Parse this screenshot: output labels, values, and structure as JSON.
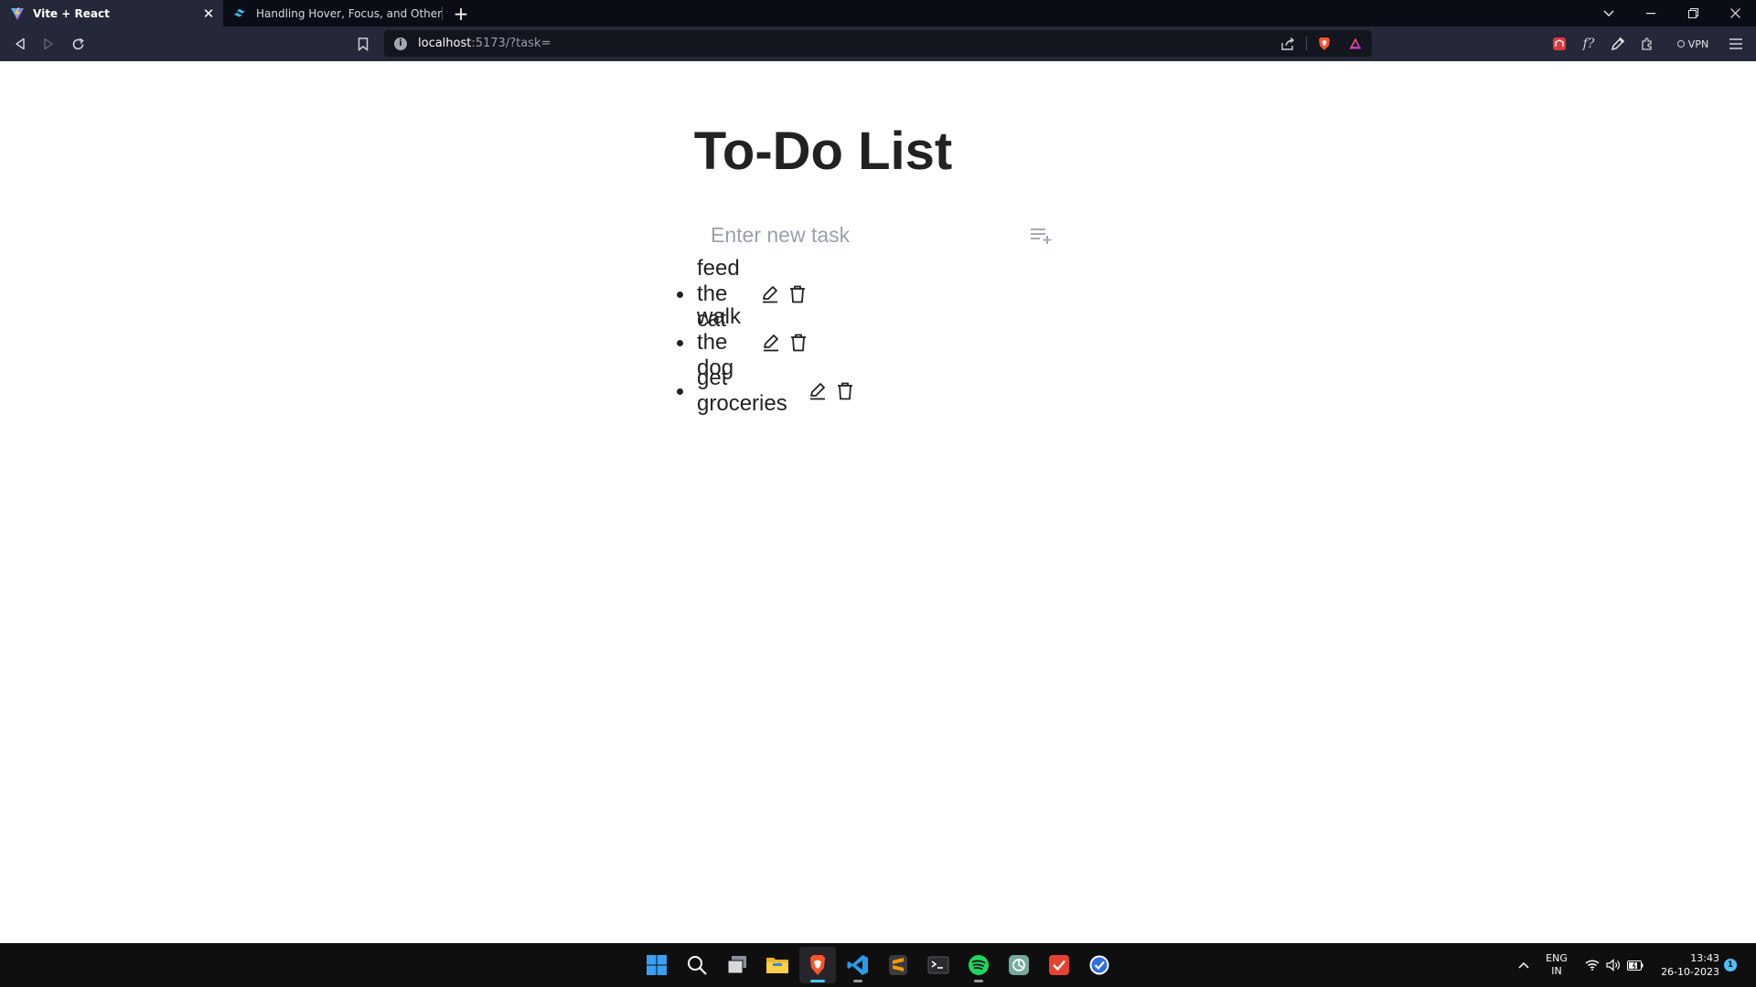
{
  "browser": {
    "tabs": [
      {
        "title": "Vite + React",
        "favicon": "vite-icon",
        "active": true
      },
      {
        "title": "Handling Hover, Focus, and Other States",
        "favicon": "tailwind-icon",
        "active": false
      }
    ],
    "new_tab_label": "+",
    "address": {
      "host": "localhost",
      "rest": ":5173/?task="
    },
    "vpn_label": "VPN"
  },
  "app": {
    "title": "To-Do List",
    "input": {
      "placeholder": "Enter new task",
      "value": ""
    },
    "tasks": [
      {
        "text": "feed the cat"
      },
      {
        "text": "walk the dog"
      },
      {
        "text": "get groceries"
      }
    ]
  },
  "taskbar": {
    "apps": [
      "windows-start-icon",
      "search-icon",
      "task-view-icon",
      "file-explorer-icon",
      "brave-icon",
      "vscode-icon",
      "sublime-text-icon",
      "terminal-icon",
      "spotify-icon",
      "chatgpt-icon",
      "todoist-icon",
      "clock-app-icon"
    ],
    "language": {
      "line1": "ENG",
      "line2": "IN"
    },
    "time": "13:43",
    "date": "26-10-2023",
    "notification_count": "1"
  },
  "colors": {
    "page_bg": "#ffffff",
    "text": "#222222",
    "placeholder": "#9aa1ad",
    "browser_chrome": "#252838",
    "taskbar_bg": "#0f0f10",
    "accent": "#4cc2ff"
  }
}
